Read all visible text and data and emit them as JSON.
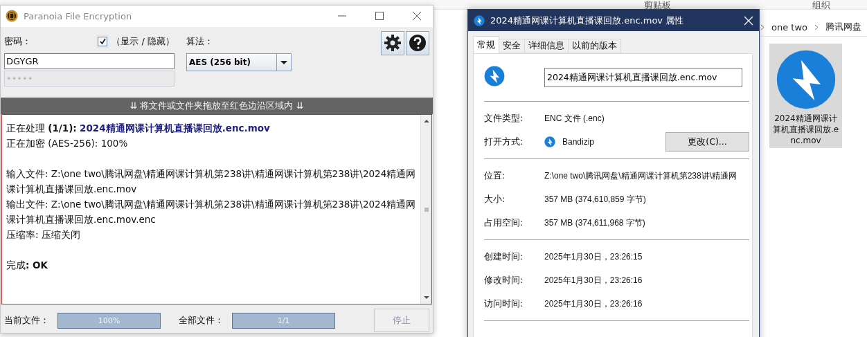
{
  "explorer": {
    "ribbon_groups": [
      "剪贴板",
      "组织"
    ],
    "breadcrumb": [
      "one two",
      "腾讯网盘"
    ],
    "files": [
      {
        "name": "2024精通网课计算机直播课回放.enc.mov",
        "selected": true
      }
    ]
  },
  "encryptor": {
    "title": "Paranoia File Encryption",
    "password": {
      "label": "密码：",
      "value": "DGYGR",
      "confirm": "•••••",
      "show": {
        "label": "（显示 / 隐藏）",
        "checked": true
      }
    },
    "algorithm": {
      "label": "算法：",
      "value": "AES (256 bit)"
    },
    "drop_hint": "⇊ 将文件或文件夹拖放至红色边沿区域内 ⇊",
    "log": [
      {
        "kind": "file",
        "text": "正在处理 **(1/1):**",
        "file": "2024精通网课计算机直播课回放.enc.mov"
      },
      {
        "kind": "line",
        "text": "正在加密 (AES-256): 100%"
      },
      {
        "kind": "gap"
      },
      {
        "kind": "line",
        "text": "输入文件: Z:\\one two\\腾讯网盘\\精通网课计算机第238讲\\精通网课计算机第238讲\\2024精通网课计算机直播课回放.enc.mov"
      },
      {
        "kind": "line",
        "text": "输出文件: Z:\\one two\\腾讯网盘\\精通网课计算机第238讲\\精通网课计算机第238讲\\2024精通网课计算机直播课回放.enc.mov.enc"
      },
      {
        "kind": "line",
        "text": "压缩率: 压缩关闭"
      },
      {
        "kind": "gap"
      },
      {
        "kind": "line",
        "text": "完成**: OK**"
      }
    ],
    "progress": [
      {
        "label": "当前文件：",
        "reading": "100%",
        "level": 1
      },
      {
        "label": "全部文件：",
        "reading": "1/1",
        "level": 1
      }
    ],
    "stop": {
      "label": "停止",
      "disabled": true
    }
  },
  "properties": {
    "title": "2024精通网课计算机直播课回放.enc.mov 属性",
    "tabs": [
      {
        "label": "常规",
        "selected": true
      },
      {
        "label": "安全",
        "selected": false
      },
      {
        "label": "详细信息",
        "selected": false
      },
      {
        "label": "以前的版本",
        "selected": false
      }
    ],
    "filename": "2024精通网课计算机直播课回放.enc.mov",
    "sections": [
      [
        {
          "label": "文件类型:",
          "value": "ENC 文件 (.enc)"
        },
        {
          "label": "打开方式:",
          "value": "Bandizip",
          "app_icon": true,
          "button": "更改(C)..."
        }
      ],
      [
        {
          "label": "位置:",
          "value": "Z:\\one two\\腾讯网盘\\精通网课计算机第238讲\\精通网"
        },
        {
          "label": "大小:",
          "value": "357 MB (374,610,859 字节)"
        },
        {
          "label": "占用空间:",
          "value": "357 MB (374,611,968 字节)"
        }
      ],
      [
        {
          "label": "创建时间:",
          "value": "2025年1月30日，23:26:15"
        },
        {
          "label": "修改时间:",
          "value": "2025年1月30日，23:26:16"
        },
        {
          "label": "访问时间:",
          "value": "2025年1月30日，23:26:16"
        }
      ]
    ]
  }
}
